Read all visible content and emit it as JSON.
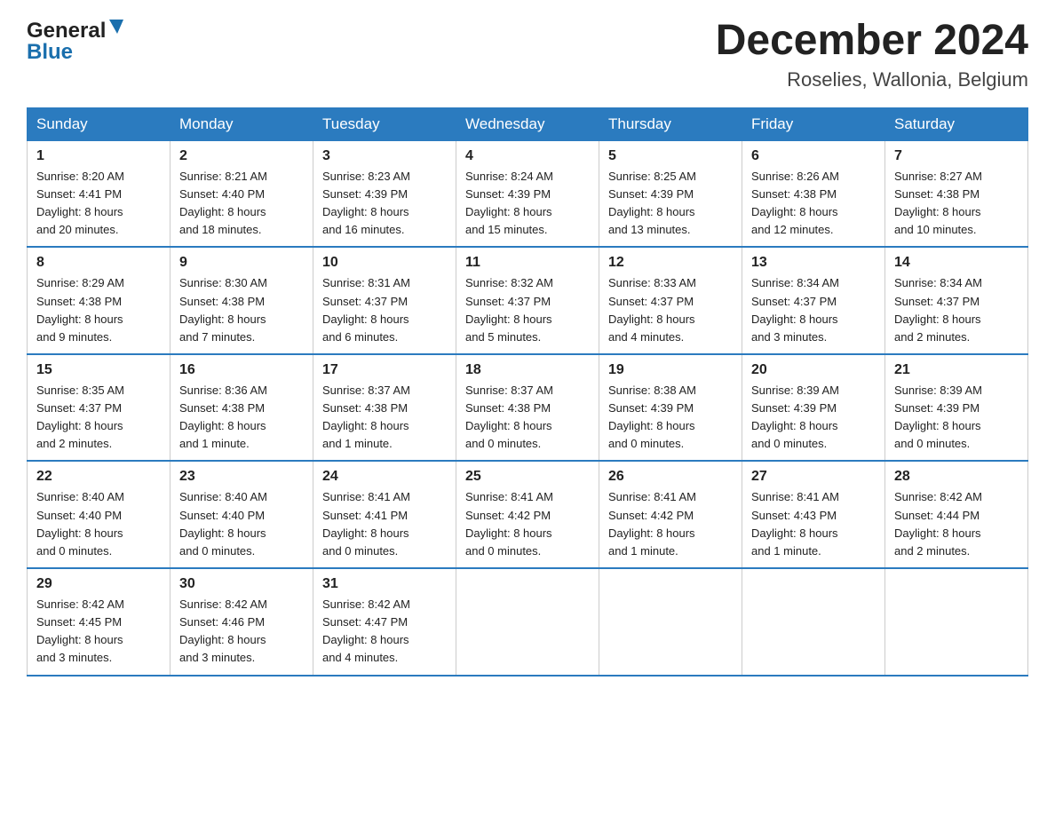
{
  "header": {
    "logo_line1": "General",
    "logo_line2": "Blue",
    "title": "December 2024",
    "subtitle": "Roselies, Wallonia, Belgium"
  },
  "weekdays": [
    "Sunday",
    "Monday",
    "Tuesday",
    "Wednesday",
    "Thursday",
    "Friday",
    "Saturday"
  ],
  "weeks": [
    [
      {
        "day": "1",
        "sunrise": "8:20 AM",
        "sunset": "4:41 PM",
        "daylight": "8 hours and 20 minutes."
      },
      {
        "day": "2",
        "sunrise": "8:21 AM",
        "sunset": "4:40 PM",
        "daylight": "8 hours and 18 minutes."
      },
      {
        "day": "3",
        "sunrise": "8:23 AM",
        "sunset": "4:39 PM",
        "daylight": "8 hours and 16 minutes."
      },
      {
        "day": "4",
        "sunrise": "8:24 AM",
        "sunset": "4:39 PM",
        "daylight": "8 hours and 15 minutes."
      },
      {
        "day": "5",
        "sunrise": "8:25 AM",
        "sunset": "4:39 PM",
        "daylight": "8 hours and 13 minutes."
      },
      {
        "day": "6",
        "sunrise": "8:26 AM",
        "sunset": "4:38 PM",
        "daylight": "8 hours and 12 minutes."
      },
      {
        "day": "7",
        "sunrise": "8:27 AM",
        "sunset": "4:38 PM",
        "daylight": "8 hours and 10 minutes."
      }
    ],
    [
      {
        "day": "8",
        "sunrise": "8:29 AM",
        "sunset": "4:38 PM",
        "daylight": "8 hours and 9 minutes."
      },
      {
        "day": "9",
        "sunrise": "8:30 AM",
        "sunset": "4:38 PM",
        "daylight": "8 hours and 7 minutes."
      },
      {
        "day": "10",
        "sunrise": "8:31 AM",
        "sunset": "4:37 PM",
        "daylight": "8 hours and 6 minutes."
      },
      {
        "day": "11",
        "sunrise": "8:32 AM",
        "sunset": "4:37 PM",
        "daylight": "8 hours and 5 minutes."
      },
      {
        "day": "12",
        "sunrise": "8:33 AM",
        "sunset": "4:37 PM",
        "daylight": "8 hours and 4 minutes."
      },
      {
        "day": "13",
        "sunrise": "8:34 AM",
        "sunset": "4:37 PM",
        "daylight": "8 hours and 3 minutes."
      },
      {
        "day": "14",
        "sunrise": "8:34 AM",
        "sunset": "4:37 PM",
        "daylight": "8 hours and 2 minutes."
      }
    ],
    [
      {
        "day": "15",
        "sunrise": "8:35 AM",
        "sunset": "4:37 PM",
        "daylight": "8 hours and 2 minutes."
      },
      {
        "day": "16",
        "sunrise": "8:36 AM",
        "sunset": "4:38 PM",
        "daylight": "8 hours and 1 minute."
      },
      {
        "day": "17",
        "sunrise": "8:37 AM",
        "sunset": "4:38 PM",
        "daylight": "8 hours and 1 minute."
      },
      {
        "day": "18",
        "sunrise": "8:37 AM",
        "sunset": "4:38 PM",
        "daylight": "8 hours and 0 minutes."
      },
      {
        "day": "19",
        "sunrise": "8:38 AM",
        "sunset": "4:39 PM",
        "daylight": "8 hours and 0 minutes."
      },
      {
        "day": "20",
        "sunrise": "8:39 AM",
        "sunset": "4:39 PM",
        "daylight": "8 hours and 0 minutes."
      },
      {
        "day": "21",
        "sunrise": "8:39 AM",
        "sunset": "4:39 PM",
        "daylight": "8 hours and 0 minutes."
      }
    ],
    [
      {
        "day": "22",
        "sunrise": "8:40 AM",
        "sunset": "4:40 PM",
        "daylight": "8 hours and 0 minutes."
      },
      {
        "day": "23",
        "sunrise": "8:40 AM",
        "sunset": "4:40 PM",
        "daylight": "8 hours and 0 minutes."
      },
      {
        "day": "24",
        "sunrise": "8:41 AM",
        "sunset": "4:41 PM",
        "daylight": "8 hours and 0 minutes."
      },
      {
        "day": "25",
        "sunrise": "8:41 AM",
        "sunset": "4:42 PM",
        "daylight": "8 hours and 0 minutes."
      },
      {
        "day": "26",
        "sunrise": "8:41 AM",
        "sunset": "4:42 PM",
        "daylight": "8 hours and 1 minute."
      },
      {
        "day": "27",
        "sunrise": "8:41 AM",
        "sunset": "4:43 PM",
        "daylight": "8 hours and 1 minute."
      },
      {
        "day": "28",
        "sunrise": "8:42 AM",
        "sunset": "4:44 PM",
        "daylight": "8 hours and 2 minutes."
      }
    ],
    [
      {
        "day": "29",
        "sunrise": "8:42 AM",
        "sunset": "4:45 PM",
        "daylight": "8 hours and 3 minutes."
      },
      {
        "day": "30",
        "sunrise": "8:42 AM",
        "sunset": "4:46 PM",
        "daylight": "8 hours and 3 minutes."
      },
      {
        "day": "31",
        "sunrise": "8:42 AM",
        "sunset": "4:47 PM",
        "daylight": "8 hours and 4 minutes."
      },
      null,
      null,
      null,
      null
    ]
  ],
  "labels": {
    "sunrise": "Sunrise:",
    "sunset": "Sunset:",
    "daylight": "Daylight:"
  }
}
